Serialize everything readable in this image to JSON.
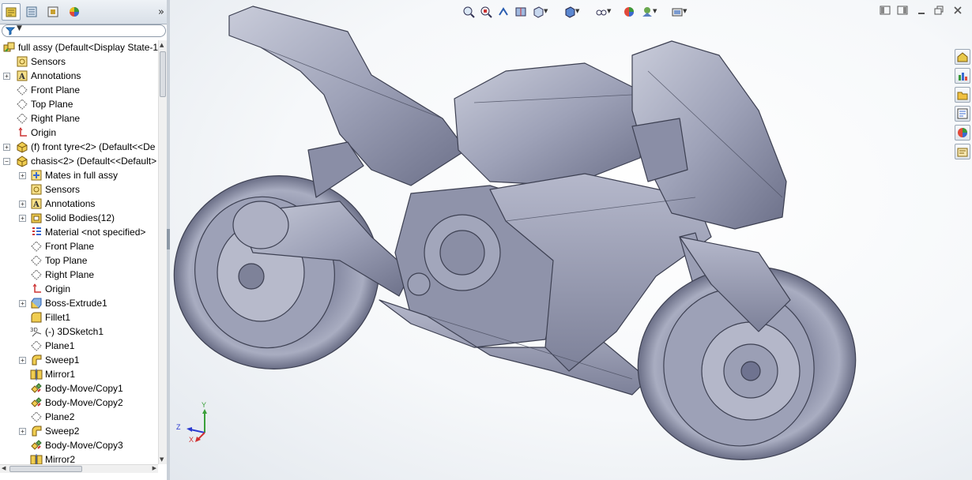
{
  "panel": {
    "tabs": [
      {
        "name": "featuremanager-tab",
        "active": true
      },
      {
        "name": "propertymanager-tab",
        "active": false
      },
      {
        "name": "configurationmanager-tab",
        "active": false
      },
      {
        "name": "displaymanager-tab",
        "active": false
      }
    ],
    "collapse_glyph": "»"
  },
  "filter": {
    "icon": "filter-icon"
  },
  "tree": [
    {
      "label": "full assy  (Default<Display State-1",
      "icon": "assembly-icon",
      "level": 0,
      "expander": ""
    },
    {
      "label": "Sensors",
      "icon": "sensors-icon",
      "level": 1,
      "expander": ""
    },
    {
      "label": "Annotations",
      "icon": "annotations-icon",
      "level": 1,
      "expander": "+"
    },
    {
      "label": "Front Plane",
      "icon": "plane-icon",
      "level": 1,
      "expander": ""
    },
    {
      "label": "Top Plane",
      "icon": "plane-icon",
      "level": 1,
      "expander": ""
    },
    {
      "label": "Right Plane",
      "icon": "plane-icon",
      "level": 1,
      "expander": ""
    },
    {
      "label": "Origin",
      "icon": "origin-icon",
      "level": 1,
      "expander": ""
    },
    {
      "label": "(f) front tyre<2> (Default<<De",
      "icon": "part-icon",
      "level": 1,
      "expander": "+"
    },
    {
      "label": "chasis<2> (Default<<Default>",
      "icon": "part-icon",
      "level": 1,
      "expander": "−"
    },
    {
      "label": "Mates in full assy",
      "icon": "mates-icon",
      "level": 2,
      "expander": "+"
    },
    {
      "label": "Sensors",
      "icon": "sensors-icon",
      "level": 2,
      "expander": ""
    },
    {
      "label": "Annotations",
      "icon": "annotations-icon",
      "level": 2,
      "expander": "+"
    },
    {
      "label": "Solid Bodies(12)",
      "icon": "solid-bodies-icon",
      "level": 2,
      "expander": "+"
    },
    {
      "label": "Material <not specified>",
      "icon": "material-icon",
      "level": 2,
      "expander": ""
    },
    {
      "label": "Front Plane",
      "icon": "plane-icon",
      "level": 2,
      "expander": ""
    },
    {
      "label": "Top Plane",
      "icon": "plane-icon",
      "level": 2,
      "expander": ""
    },
    {
      "label": "Right Plane",
      "icon": "plane-icon",
      "level": 2,
      "expander": ""
    },
    {
      "label": "Origin",
      "icon": "origin-icon",
      "level": 2,
      "expander": ""
    },
    {
      "label": "Boss-Extrude1",
      "icon": "extrude-icon",
      "level": 2,
      "expander": "+"
    },
    {
      "label": "Fillet1",
      "icon": "fillet-icon",
      "level": 2,
      "expander": ""
    },
    {
      "label": "(-) 3DSketch1",
      "icon": "3dsketch-icon",
      "level": 2,
      "expander": ""
    },
    {
      "label": "Plane1",
      "icon": "plane-icon",
      "level": 2,
      "expander": ""
    },
    {
      "label": "Sweep1",
      "icon": "sweep-icon",
      "level": 2,
      "expander": "+"
    },
    {
      "label": "Mirror1",
      "icon": "mirror-icon",
      "level": 2,
      "expander": ""
    },
    {
      "label": "Body-Move/Copy1",
      "icon": "body-move-icon",
      "level": 2,
      "expander": ""
    },
    {
      "label": "Body-Move/Copy2",
      "icon": "body-move-icon",
      "level": 2,
      "expander": ""
    },
    {
      "label": "Plane2",
      "icon": "plane-icon",
      "level": 2,
      "expander": ""
    },
    {
      "label": "Sweep2",
      "icon": "sweep-icon",
      "level": 2,
      "expander": "+"
    },
    {
      "label": "Body-Move/Copy3",
      "icon": "body-move-icon",
      "level": 2,
      "expander": ""
    },
    {
      "label": "Mirror2",
      "icon": "mirror-icon",
      "level": 2,
      "expander": ""
    }
  ],
  "heads_up_toolbar": [
    "zoom-to-fit-icon",
    "zoom-to-area-icon",
    "previous-view-icon",
    "section-view-icon",
    "view-orientation-icon",
    "display-style-icon",
    "hide-show-items-icon",
    "edit-appearance-icon",
    "apply-scene-icon",
    "view-settings-icon"
  ],
  "window_controls": [
    "tile-left-icon",
    "tile-right-icon",
    "minimize-icon",
    "restore-icon",
    "close-icon"
  ],
  "task_pane": [
    "solidworks-resources-icon",
    "design-library-icon",
    "file-explorer-icon",
    "view-palette-icon",
    "appearances-scenes-icon",
    "custom-properties-icon"
  ],
  "triad": {
    "x": "X",
    "y": "Y",
    "z": "Z"
  },
  "colors": {
    "model": "#9fa3ba",
    "model_dark": "#5c6078",
    "accent": "#3a6ea5"
  }
}
